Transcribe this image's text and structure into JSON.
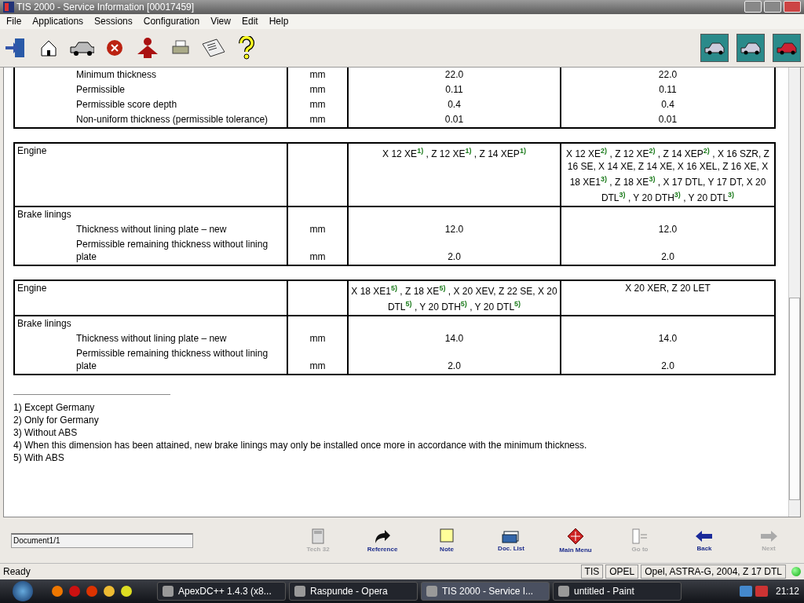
{
  "window": {
    "title": "TIS 2000 - Service Information [00017459]"
  },
  "menu": [
    "File",
    "Applications",
    "Sessions",
    "Configuration",
    "View",
    "Edit",
    "Help"
  ],
  "tables": [
    {
      "rows": [
        {
          "kind": "item",
          "label": "Minimum thickness",
          "unit": "mm",
          "values": [
            "22.0",
            "22.0"
          ]
        },
        {
          "kind": "item",
          "label": "Permissible",
          "unit": "mm",
          "values": [
            "0.11",
            "0.11"
          ]
        },
        {
          "kind": "item",
          "label": "Permissible score depth",
          "unit": "mm",
          "values": [
            "0.4",
            "0.4"
          ]
        },
        {
          "kind": "item",
          "label": "Non-uniform thickness (permissible tolerance)",
          "unit": "mm",
          "values": [
            "0.01",
            "0.01"
          ]
        }
      ]
    },
    {
      "rows": [
        {
          "kind": "heading",
          "label": "Engine",
          "values": [
            "X 12 XE$^{1)}$ , Z 12 XE$^{1)}$ , Z 14 XEP$^{1)}$",
            "X 12 XE$^{2)}$ , Z 12 XE$^{2)}$ , Z 14 XEP$^{2)}$ , X 16 SZR, Z 16 SE, X 14 XE, Z 14 XE, X 16 XEL, Z 16 XE, X 18 XE1$^{3)}$ , Z 18 XE$^{3)}$ , X 17 DTL, Y 17 DT, X 20 DTL$^{3)}$ , Y 20 DTH$^{3)}$ , Y 20 DTL$^{3)}$"
          ]
        },
        {
          "kind": "heading",
          "label": "Brake linings"
        },
        {
          "kind": "item",
          "label": "Thickness without lining plate – new",
          "unit": "mm",
          "values": [
            "12.0",
            "12.0"
          ]
        },
        {
          "kind": "item",
          "label": "Permissible remaining thickness without lining plate",
          "unit": "mm",
          "values": [
            "2.0",
            "2.0"
          ]
        }
      ]
    },
    {
      "rows": [
        {
          "kind": "heading",
          "label": "Engine",
          "values": [
            "X 18 XE1$^{5)}$ , Z 18 XE$^{5)}$ , X 20 XEV, Z 22 SE, X 20 DTL$^{5)}$ , Y 20 DTH$^{5)}$ , Y 20 DTL$^{5)}$",
            "X 20 XER, Z 20 LET"
          ]
        },
        {
          "kind": "heading",
          "label": "Brake linings"
        },
        {
          "kind": "item",
          "label": "Thickness without lining plate – new",
          "unit": "mm",
          "values": [
            "14.0",
            "14.0"
          ]
        },
        {
          "kind": "item",
          "label": "Permissible remaining thickness without lining plate",
          "unit": "mm",
          "values": [
            "2.0",
            "2.0"
          ]
        }
      ]
    }
  ],
  "footnotes": [
    "1) Except Germany",
    "2) Only for Germany",
    "3) Without ABS",
    "4) When this dimension has been attained, new brake linings may only be installed once more in accordance with the minimum thickness.",
    "5) With ABS"
  ],
  "document_field": {
    "value": "Document1/1"
  },
  "nav_buttons": [
    {
      "kind": "calculator",
      "label": "Tech 32",
      "disabled": true
    },
    {
      "kind": "reference",
      "label": "Reference",
      "disabled": false
    },
    {
      "kind": "note",
      "label": "Note",
      "disabled": false
    },
    {
      "kind": "doclist",
      "label": "Doc. List",
      "disabled": false
    },
    {
      "kind": "mainmenu",
      "label": "Main Menu",
      "disabled": false
    },
    {
      "kind": "goto",
      "label": "Go to",
      "disabled": true
    },
    {
      "kind": "back",
      "label": "Back",
      "disabled": false
    },
    {
      "kind": "next",
      "label": "Next",
      "disabled": true
    }
  ],
  "status_bar": {
    "text": "Ready",
    "fields": [
      "TIS",
      "OPEL",
      "Opel, ASTRA-G, 2004, Z 17 DTL"
    ]
  },
  "taskbar": {
    "tasks": [
      {
        "label": "ApexDC++ 1.4.3 (x8...",
        "selected": false
      },
      {
        "label": "Raspunde - Opera",
        "selected": false
      },
      {
        "label": "TIS 2000 - Service I...",
        "selected": true
      },
      {
        "label": "untitled - Paint",
        "selected": false
      }
    ],
    "clock": "21:12"
  }
}
